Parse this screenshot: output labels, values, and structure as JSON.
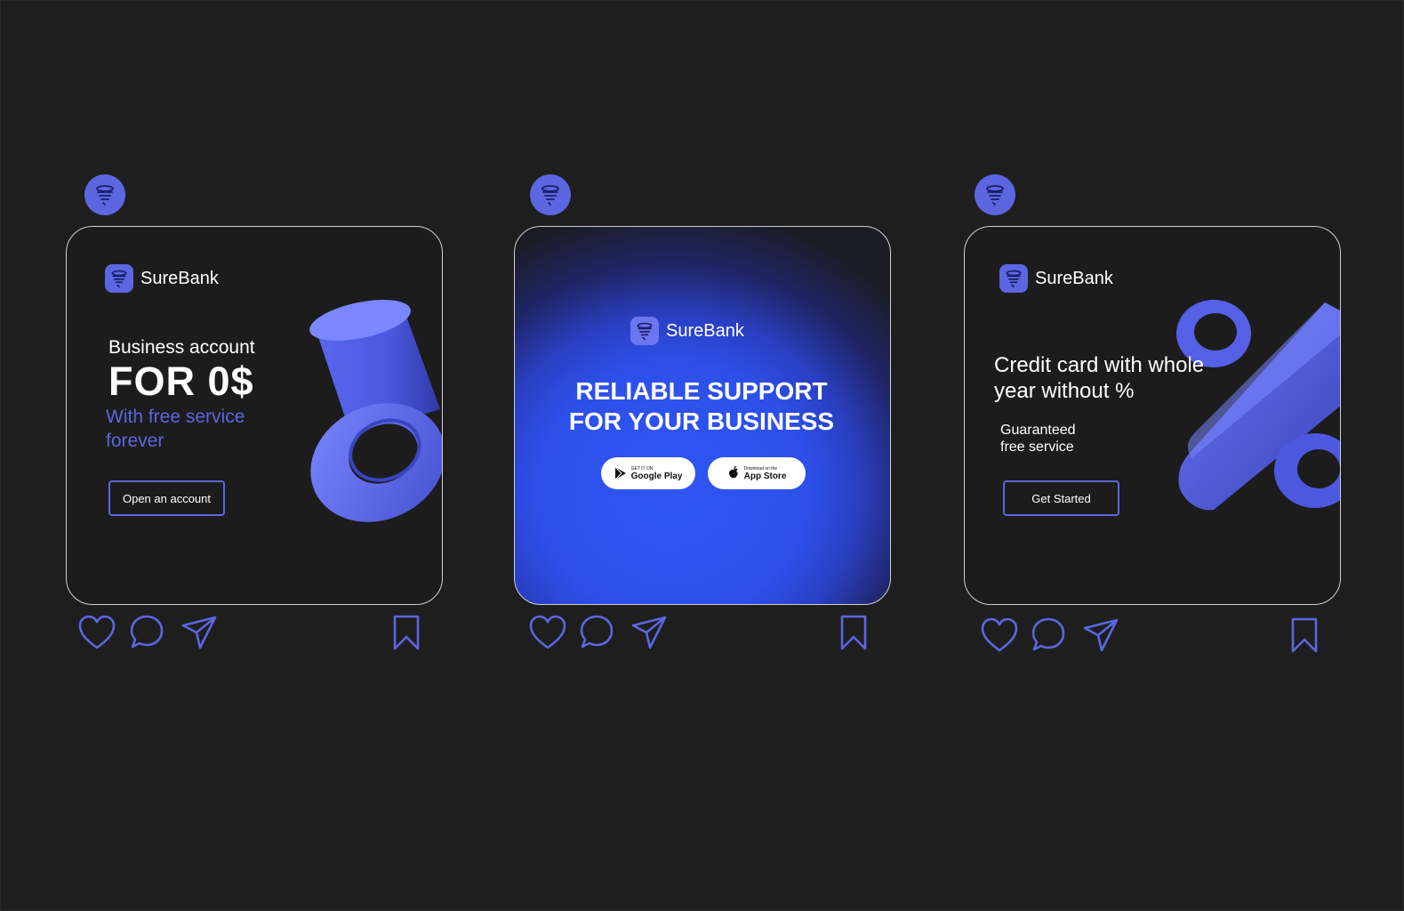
{
  "brand": {
    "name": "SureBank",
    "accent": "#5b66e0",
    "background": "#1e1e1e",
    "blue": "#2f55f2"
  },
  "post1": {
    "title": "Business account",
    "headline": "FOR 0$",
    "subtitle_line1": "With free service",
    "subtitle_line2": "forever",
    "button": "Open an account"
  },
  "post2": {
    "headline_line1": "RELIABLE SUPPORT",
    "headline_line2": "FOR YOUR BUSINESS",
    "google_small": "GET IT ON",
    "google_big": "Google Play",
    "apple_small": "Download on the",
    "apple_big": "App Store"
  },
  "post3": {
    "title_line1": "Credit card with whole",
    "title_line2": "year without %",
    "sub_line1": "Guaranteed",
    "sub_line2": "free service",
    "button": "Get Started"
  },
  "icons": [
    "heart-icon",
    "comment-icon",
    "send-icon",
    "bookmark-icon"
  ]
}
